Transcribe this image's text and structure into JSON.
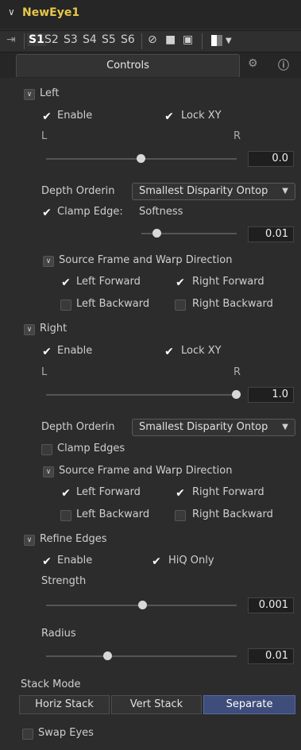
{
  "window": {
    "title": "NewEye1"
  },
  "toolbar": {
    "versions": [
      "S1",
      "S2",
      "S3",
      "S4",
      "S5",
      "S6"
    ],
    "active_version": "S1"
  },
  "tabs": {
    "controls": "Controls"
  },
  "left": {
    "header": "Left",
    "enable": "Enable",
    "lock_xy": "Lock XY",
    "l_label": "L",
    "r_label": "R",
    "lr_value": "0.0",
    "lr_fraction": 0.5,
    "depth_label": "Depth Orderin",
    "depth_value": "Smallest Disparity Ontop",
    "clamp_edges": "Clamp Edge:",
    "softness": "Softness",
    "softness_value": "0.01",
    "source_header": "Source Frame and Warp Direction",
    "left_forward": "Left Forward",
    "right_forward": "Right Forward",
    "left_backward": "Left Backward",
    "right_backward": "Right Backward"
  },
  "right": {
    "header": "Right",
    "enable": "Enable",
    "lock_xy": "Lock XY",
    "l_label": "L",
    "r_label": "R",
    "lr_value": "1.0",
    "lr_fraction": 1.0,
    "depth_label": "Depth Orderin",
    "depth_value": "Smallest Disparity Ontop",
    "clamp_edges": "Clamp Edges",
    "source_header": "Source Frame and Warp Direction",
    "left_forward": "Left Forward",
    "right_forward": "Right Forward",
    "left_backward": "Left Backward",
    "right_backward": "Right Backward"
  },
  "refine": {
    "header": "Refine Edges",
    "enable": "Enable",
    "hiq_only": "HiQ Only",
    "strength": "Strength",
    "strength_value": "0.001",
    "radius": "Radius",
    "radius_value": "0.01"
  },
  "stack": {
    "label": "Stack Mode",
    "horiz": "Horiz Stack",
    "vert": "Vert Stack",
    "separate": "Separate",
    "selected": "Separate"
  },
  "swap_eyes": "Swap Eyes",
  "colors": {
    "title": "#e7c84a",
    "selected_button": "#3e4d7a"
  },
  "icons": [
    "chevron-down-icon",
    "pin-icon",
    "stop-icon",
    "lock-icon",
    "save-icon",
    "color-swatch-icon",
    "dropdown-arrow-icon",
    "gear-icon",
    "info-icon"
  ]
}
